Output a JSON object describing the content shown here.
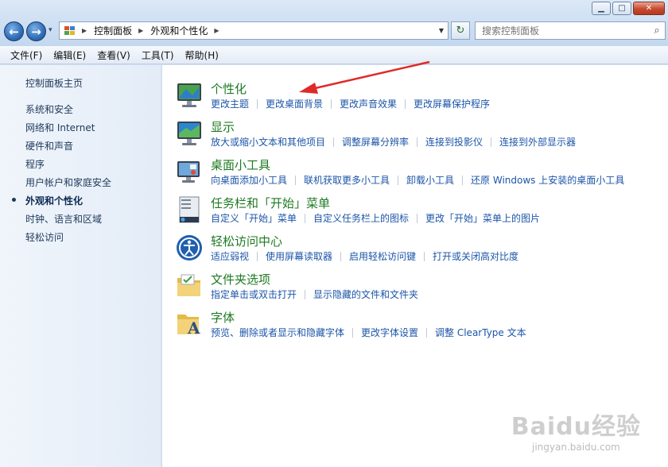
{
  "window": {
    "minimize_glyph": "▁",
    "maximize_glyph": "□",
    "close_glyph": "✕"
  },
  "nav": {
    "back_glyph": "←",
    "forward_glyph": "→",
    "history_glyph": "▾",
    "breadcrumb": [
      "控制面板",
      "外观和个性化"
    ],
    "refresh_glyph": "↻"
  },
  "search": {
    "placeholder": "搜索控制面板",
    "icon": "search-icon"
  },
  "menubar": [
    "文件(F)",
    "编辑(E)",
    "查看(V)",
    "工具(T)",
    "帮助(H)"
  ],
  "sidebar": {
    "home": "控制面板主页",
    "items": [
      "系统和安全",
      "网络和 Internet",
      "硬件和声音",
      "程序",
      "用户帐户和家庭安全",
      "外观和个性化",
      "时钟、语言和区域",
      "轻松访问"
    ],
    "current": "外观和个性化"
  },
  "categories": [
    {
      "title": "个性化",
      "icon": "personalization-monitor-icon",
      "links": [
        "更改主题",
        "更改桌面背景",
        "更改声音效果",
        "更改屏幕保护程序"
      ]
    },
    {
      "title": "显示",
      "icon": "display-monitor-icon",
      "links": [
        "放大或缩小文本和其他项目",
        "调整屏幕分辨率",
        "连接到投影仪",
        "连接到外部显示器"
      ]
    },
    {
      "title": "桌面小工具",
      "icon": "desktop-gadgets-icon",
      "links": [
        "向桌面添加小工具",
        "联机获取更多小工具",
        "卸载小工具",
        "还原 Windows 上安装的桌面小工具"
      ]
    },
    {
      "title": "任务栏和「开始」菜单",
      "icon": "taskbar-start-menu-icon",
      "links": [
        "自定义「开始」菜单",
        "自定义任务栏上的图标",
        "更改「开始」菜单上的图片"
      ]
    },
    {
      "title": "轻松访问中心",
      "icon": "ease-of-access-icon",
      "links": [
        "适应弱视",
        "使用屏幕读取器",
        "启用轻松访问键",
        "打开或关闭高对比度"
      ]
    },
    {
      "title": "文件夹选项",
      "icon": "folder-options-icon",
      "links": [
        "指定单击或双击打开",
        "显示隐藏的文件和文件夹"
      ]
    },
    {
      "title": "字体",
      "icon": "fonts-folder-icon",
      "links": [
        "预览、删除或者显示和隐藏字体",
        "更改字体设置",
        "调整 ClearType 文本"
      ]
    }
  ],
  "watermark": {
    "logo": "Baidu经验",
    "url": "jingyan.baidu.com"
  },
  "colors": {
    "title_green": "#1e7a22",
    "link_blue": "#1c55a8",
    "annotation_red": "#e02a2a"
  }
}
